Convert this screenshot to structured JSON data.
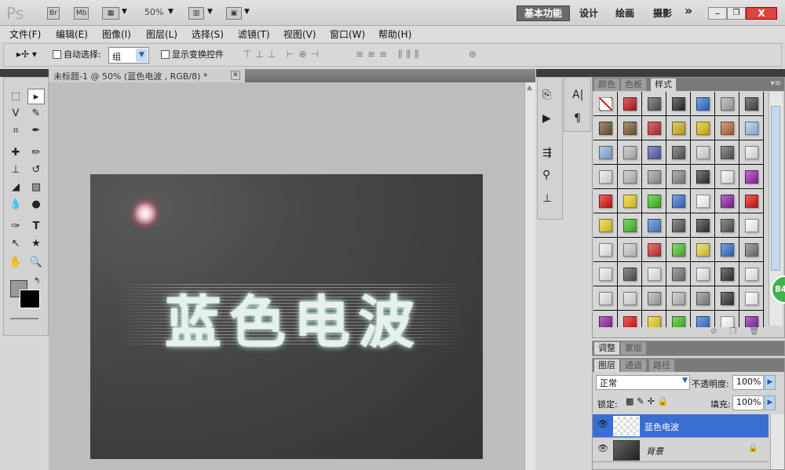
{
  "titlebar": {
    "logo": "Ps",
    "bridge": "Br",
    "mini_bridge": "Mb",
    "zoom": "50%",
    "workspaces": [
      "基本功能",
      "设计",
      "绘画",
      "摄影"
    ],
    "more": "»",
    "minimize": "–",
    "restore": "❐",
    "close": "X"
  },
  "menu": [
    "文件(F)",
    "编辑(E)",
    "图像(I)",
    "图层(L)",
    "选择(S)",
    "滤镜(T)",
    "视图(V)",
    "窗口(W)",
    "帮助(H)"
  ],
  "options": {
    "auto_select_label": "自动选择:",
    "auto_select_value": "组",
    "show_transform_label": "显示变换控件"
  },
  "document": {
    "tab_title": "未标题-1 @ 50% (蓝色电波 , RGB/8) *",
    "text": "蓝色电波"
  },
  "panels": {
    "styles_tabs": [
      "颜色",
      "色板",
      "样式"
    ],
    "adjust_tabs": [
      "调整",
      "蒙版"
    ],
    "layers_tabs": [
      "图层",
      "通道",
      "路径"
    ]
  },
  "layers": {
    "blend_mode": "正常",
    "opacity_label": "不透明度:",
    "opacity": "100%",
    "lock_label": "锁定:",
    "fill_label": "填充:",
    "fill": "100%",
    "items": [
      {
        "name": "蓝色电波",
        "selected": true
      },
      {
        "name": "背景",
        "locked": true
      }
    ]
  },
  "badge": "84",
  "style_colors": [
    "none",
    "#c0161a",
    "#555555",
    "#2a2a2a",
    "#2f6fd0",
    "#a8a8a8",
    "#444444",
    "#6b5530",
    "#7a5a30",
    "#c22a2a",
    "#d4b020",
    "#e0c010",
    "#b86a40",
    "#9cc4ee",
    "#8ab0d8",
    "#bbbbbb",
    "#5a5ab0",
    "#5a5a5a",
    "#dcdcdc",
    "#5a5a5a",
    "#eeeeee",
    "#e8e8e8",
    "#bdbdbd",
    "#9a9a9a",
    "#888888",
    "#333333",
    "#f4f4f4",
    "#9b1fb0",
    "#e01010",
    "#f0d020",
    "#40c020",
    "#3a70d0",
    "#ffffff",
    "#8a1fa0",
    "#e01010",
    "#e8d020",
    "#40c020",
    "#4a80d0",
    "#555555",
    "#333333",
    "#555555",
    "#ffffff",
    "#f0f0f0",
    "#cccccc",
    "#d03030",
    "#50c030",
    "#e8d040",
    "#3070c8",
    "#777777",
    "#eeeeee",
    "#555555",
    "#eeeeee",
    "#777777",
    "#eeeeee",
    "#333333",
    "#f4f4f4",
    "#e8e8e8",
    "#e0e0e0",
    "#aaaaaa",
    "#bbbbbb",
    "#888888",
    "#333333",
    "#ffffff",
    "#8a1fa0",
    "#e01010",
    "#e8d020",
    "#40c020",
    "#3a70d0",
    "#ffffff",
    "#8a1fa0"
  ]
}
